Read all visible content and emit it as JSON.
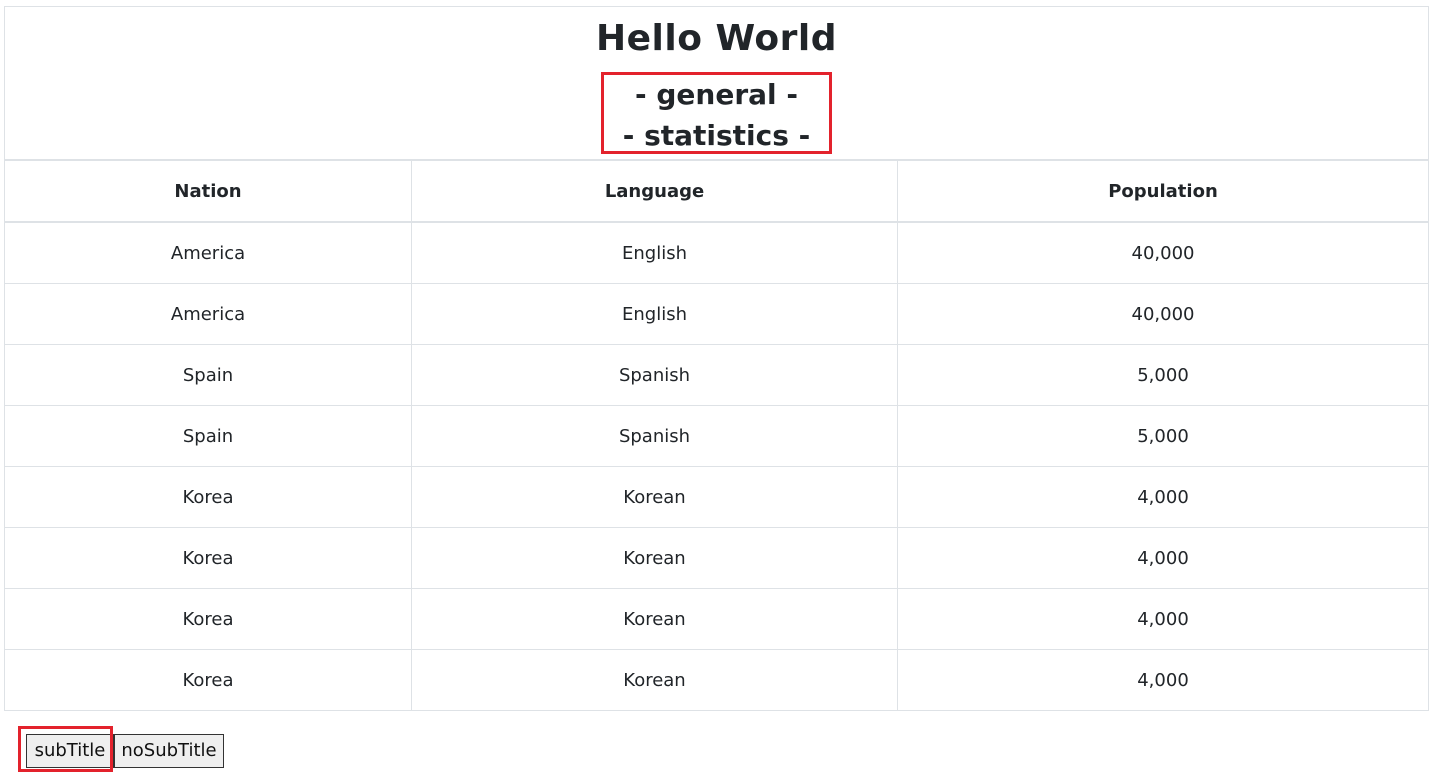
{
  "caption": {
    "title": "Hello World",
    "subtitle_lines": [
      "- general -",
      "- statistics -"
    ]
  },
  "table": {
    "headers": [
      "Nation",
      "Language",
      "Population"
    ],
    "rows": [
      [
        "America",
        "English",
        "40,000"
      ],
      [
        "America",
        "English",
        "40,000"
      ],
      [
        "Spain",
        "Spanish",
        "5,000"
      ],
      [
        "Spain",
        "Spanish",
        "5,000"
      ],
      [
        "Korea",
        "Korean",
        "4,000"
      ],
      [
        "Korea",
        "Korean",
        "4,000"
      ],
      [
        "Korea",
        "Korean",
        "4,000"
      ],
      [
        "Korea",
        "Korean",
        "4,000"
      ]
    ]
  },
  "buttons": {
    "subtitle_label": "subTitle",
    "nosubtitle_label": "noSubTitle"
  },
  "colors": {
    "highlight": "#e3222c",
    "border": "#dee2e6"
  }
}
